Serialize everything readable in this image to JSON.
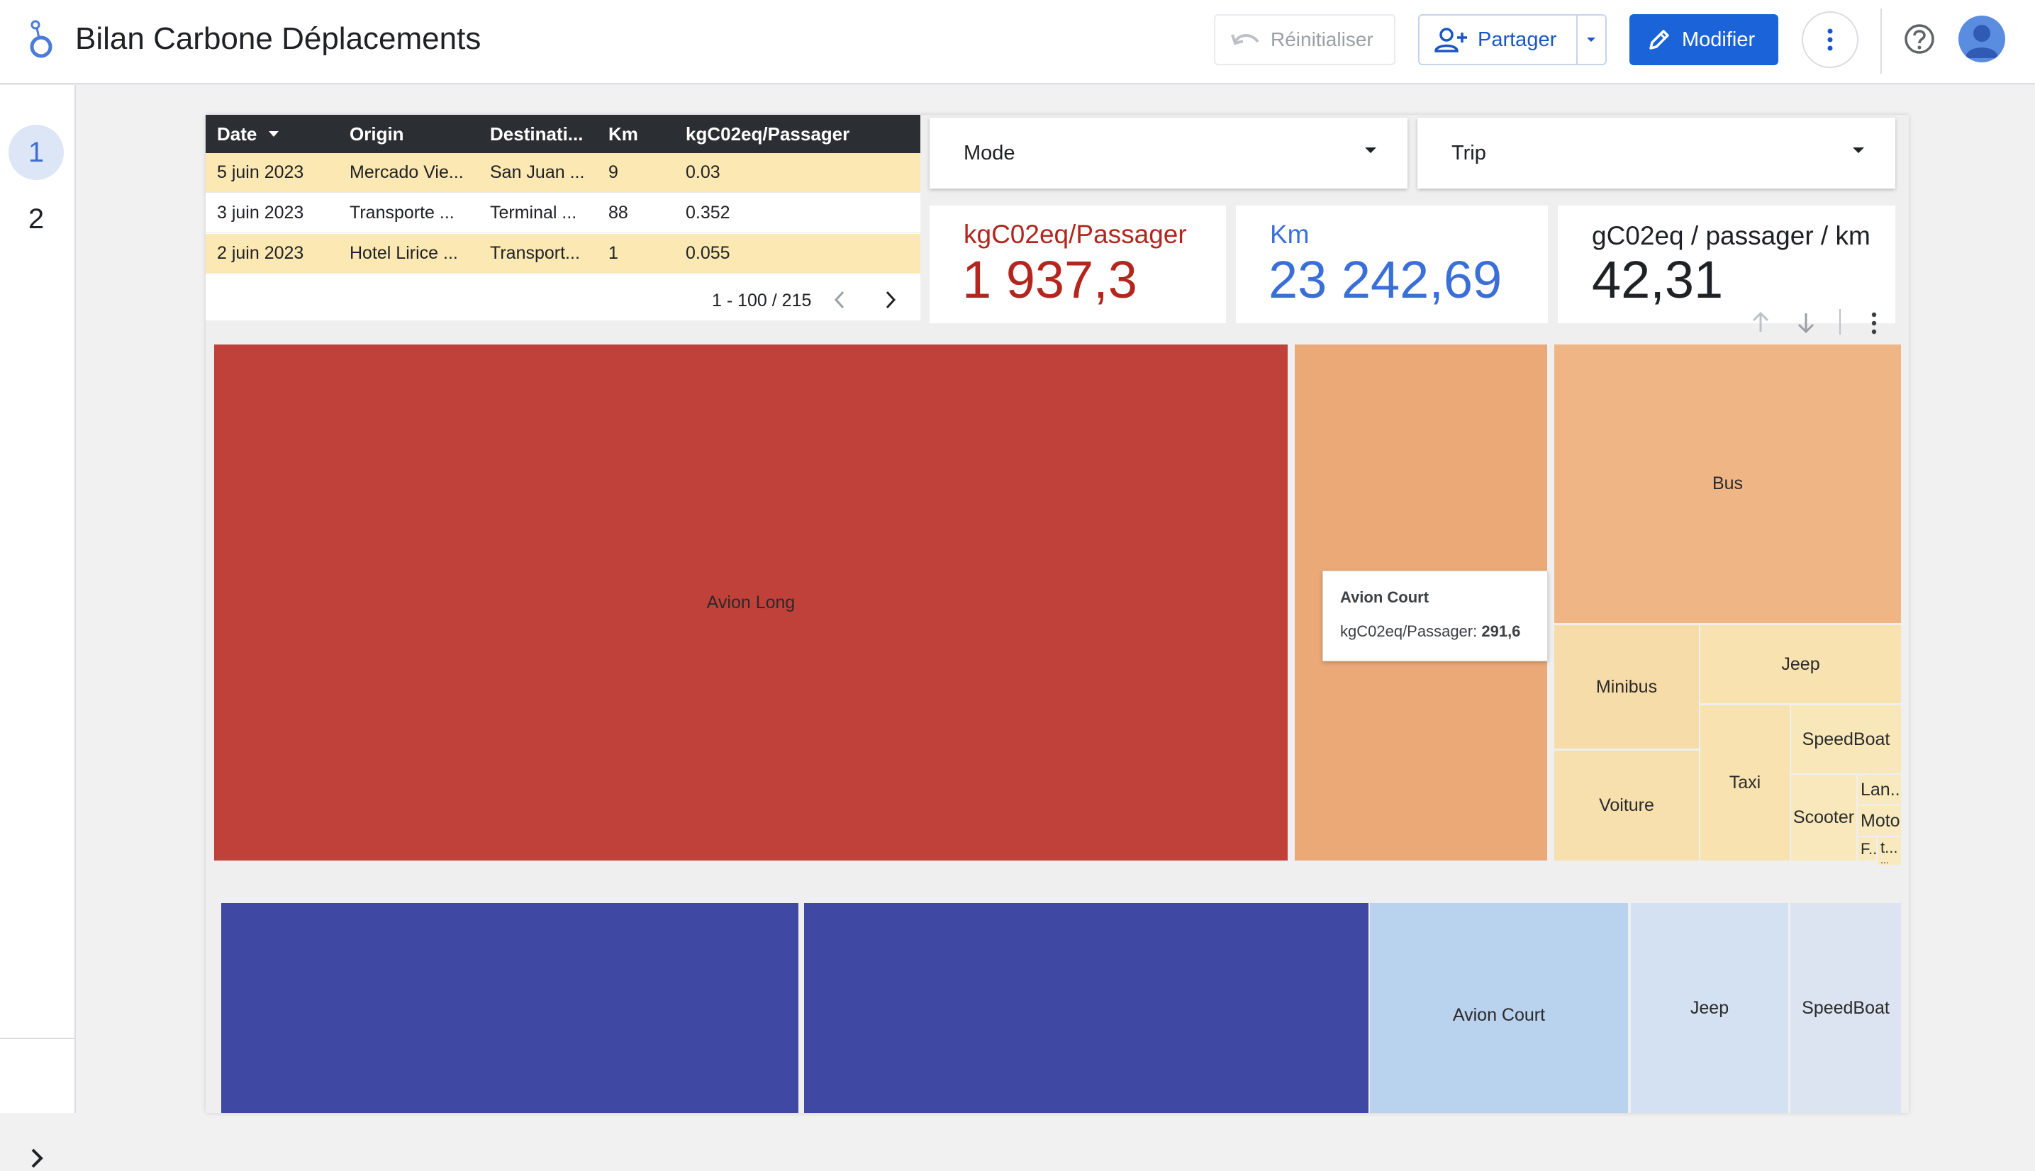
{
  "header": {
    "title": "Bilan Carbone Déplacements",
    "reset_label": "Réinitialiser",
    "share_label": "Partager",
    "edit_label": "Modifier"
  },
  "sidebar": {
    "pages": [
      "1",
      "2"
    ],
    "active_page": "1"
  },
  "table": {
    "columns": [
      "Date",
      "Origin",
      "Destinati...",
      "Km",
      "kgC02eq/Passager"
    ],
    "sort_column": "Date",
    "rows": [
      [
        "5 juin 2023",
        "Mercado Vie...",
        "San Juan ...",
        "9",
        "0.03"
      ],
      [
        "3 juin 2023",
        "Transporte ...",
        "Terminal ...",
        "88",
        "0.352"
      ],
      [
        "2 juin 2023",
        "Hotel Lirice ...",
        "Transport...",
        "1",
        "0.055"
      ]
    ],
    "pagination": "1 - 100 / 215"
  },
  "filters": {
    "mode_label": "Mode",
    "trip_label": "Trip"
  },
  "scorecards": [
    {
      "label": "kgC02eq/Passager",
      "value": "1 937,3",
      "color": "#b3261e"
    },
    {
      "label": "Km",
      "value": "23 242,69",
      "color": "#3a6fd8"
    },
    {
      "label": "gC02eq / passager / km",
      "value": "42,31",
      "color": "#202124"
    }
  ],
  "treemap_top": {
    "blocks": [
      {
        "label": "Avion Long",
        "color": "#c0403a"
      },
      {
        "label": "",
        "color": "#eba978"
      },
      {
        "label": "Bus",
        "color": "#efb585"
      },
      {
        "label": "Minibus",
        "color": "#f6dca8"
      },
      {
        "label": "Jeep",
        "color": "#f7e2b0"
      },
      {
        "label": "SpeedBoat",
        "color": "#f8e7b8"
      },
      {
        "label": "Voiture",
        "color": "#f7e0ad"
      },
      {
        "label": "Taxi",
        "color": "#f7e2b0"
      },
      {
        "label": "Scooter",
        "color": "#f8e8bb"
      },
      {
        "label": "Lan...",
        "color": "#f8eabe"
      },
      {
        "label": "Moto",
        "color": "#f8eabe"
      },
      {
        "label": "t...",
        "color": "#f8eabe"
      },
      {
        "label": "F...",
        "color": "#f8eabe"
      },
      {
        "label": "...",
        "color": "#f8eabe"
      }
    ],
    "tooltip": {
      "title": "Avion Court",
      "metric": "kgC02eq/Passager:",
      "value": "291,6"
    }
  },
  "treemap_bottom": {
    "blocks": [
      {
        "label": "",
        "color": "#3f49a3"
      },
      {
        "label": "",
        "color": "#3f49a3"
      },
      {
        "label": "Avion Court",
        "color": "#b9d2ee"
      },
      {
        "label": "Jeep",
        "color": "#d3e1f2"
      },
      {
        "label": "SpeedBoat",
        "color": "#dbe4f0"
      }
    ]
  }
}
